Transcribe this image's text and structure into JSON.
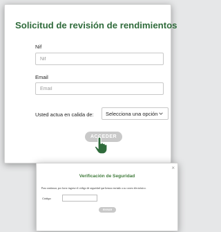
{
  "form": {
    "title": "Solicitud de revisión de rendimientos",
    "nif_label": "Nif",
    "nif_placeholder": "Nif",
    "email_label": "Email",
    "email_placeholder": "Email",
    "role_label": "Usted actua en calida de:",
    "role_selected": "Selecciona una opción",
    "submit_label": "ACCEDER"
  },
  "security_modal": {
    "title": "Verificación de Seguridad",
    "message": "Para continuar, por favor ingrese el código de seguridad que hemos enviado a su correo electrónico.",
    "code_label": "Código",
    "submit_label": "ENVIAR",
    "close_icon": "×"
  },
  "colors": {
    "accent_green": "#2f6b3b",
    "button_gray": "#c9c9c9"
  },
  "icons": [
    "chevron-down-icon",
    "hand-pointer-icon",
    "close-icon"
  ]
}
